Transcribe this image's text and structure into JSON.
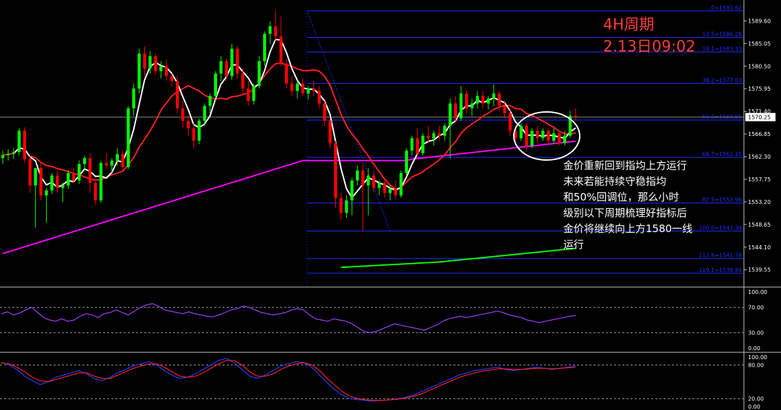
{
  "chart_data": {
    "type": "candlestick",
    "timeframe_label": "4H周期",
    "timestamp_label": "2.13日09:02",
    "commentary": [
      "金价重新回到指均上方运行",
      "未来若能持续守稳指均",
      "和50%回调位，那么小时",
      "级别以下周期梳理好指标后",
      "金价将继续向上方1580一线",
      "运行"
    ],
    "colors": {
      "up": "#00ff00",
      "down": "#ff0000",
      "ma_fast": "#ffffff",
      "ma_mid": "#ff2020",
      "ma_slow": "#ff00ff",
      "ma_long": "#00ff00",
      "fib": "#2030ff",
      "rsi": "#a040ff",
      "stoch_k": "#2040ff",
      "stoch_d": "#ff2020",
      "current": "#808080"
    },
    "price_axis": {
      "ylim": [
        1536.2,
        1593.8
      ],
      "ticks": [
        "1589.60",
        "1585.05",
        "1580.50",
        "1575.95",
        "1571.40",
        "1566.85",
        "1562.30",
        "1557.75",
        "1553.20",
        "1548.65",
        "1544.10",
        "1539.55"
      ],
      "current_price": "1570.25"
    },
    "fibonacci": [
      {
        "label": "0",
        "price": 1591.62,
        "text": "1591.62"
      },
      {
        "label": "12.5",
        "price": 1586.28,
        "text": "1586.28"
      },
      {
        "label": "19.1",
        "price": 1583.33,
        "text": "1583.33"
      },
      {
        "label": "38.2",
        "price": 1577.03,
        "text": "1577.03"
      },
      {
        "label": "50.0",
        "price": 1569.65,
        "text": "1569.65"
      },
      {
        "label": "66.7",
        "price": 1562.15,
        "text": "1562.15"
      },
      {
        "label": "82.5",
        "price": 1552.96,
        "text": "1552.96"
      },
      {
        "label": "100.0",
        "price": 1547.34,
        "text": "1547.34"
      },
      {
        "label": "112.8",
        "price": 1541.78,
        "text": "1541.78"
      },
      {
        "label": "119.1",
        "price": 1538.84,
        "text": "1538.84"
      }
    ],
    "candles": [
      {
        "o": 1562.0,
        "h": 1563.5,
        "l": 1560.8,
        "c": 1562.6
      },
      {
        "o": 1562.6,
        "h": 1563.8,
        "l": 1561.5,
        "c": 1562.9
      },
      {
        "o": 1562.9,
        "h": 1564.0,
        "l": 1561.8,
        "c": 1563.2
      },
      {
        "o": 1563.2,
        "h": 1568.0,
        "l": 1562.5,
        "c": 1567.5
      },
      {
        "o": 1567.5,
        "h": 1568.2,
        "l": 1561.0,
        "c": 1561.8
      },
      {
        "o": 1561.8,
        "h": 1562.5,
        "l": 1555.0,
        "c": 1556.5
      },
      {
        "o": 1556.5,
        "h": 1560.0,
        "l": 1548.0,
        "c": 1560.0
      },
      {
        "o": 1560.0,
        "h": 1561.0,
        "l": 1553.5,
        "c": 1554.5
      },
      {
        "o": 1554.5,
        "h": 1556.0,
        "l": 1549.0,
        "c": 1555.5
      },
      {
        "o": 1555.5,
        "h": 1559.0,
        "l": 1554.8,
        "c": 1558.5
      },
      {
        "o": 1558.5,
        "h": 1559.5,
        "l": 1555.0,
        "c": 1556.0
      },
      {
        "o": 1556.0,
        "h": 1557.0,
        "l": 1553.2,
        "c": 1556.5
      },
      {
        "o": 1556.5,
        "h": 1559.5,
        "l": 1555.8,
        "c": 1559.0
      },
      {
        "o": 1559.0,
        "h": 1560.0,
        "l": 1557.0,
        "c": 1557.5
      },
      {
        "o": 1557.5,
        "h": 1561.5,
        "l": 1556.8,
        "c": 1560.8
      },
      {
        "o": 1560.8,
        "h": 1562.5,
        "l": 1559.5,
        "c": 1562.0
      },
      {
        "o": 1562.0,
        "h": 1563.0,
        "l": 1555.0,
        "c": 1557.0
      },
      {
        "o": 1557.0,
        "h": 1557.5,
        "l": 1552.5,
        "c": 1553.5
      },
      {
        "o": 1553.5,
        "h": 1561.5,
        "l": 1553.0,
        "c": 1561.0
      },
      {
        "o": 1561.0,
        "h": 1563.0,
        "l": 1559.8,
        "c": 1560.5
      },
      {
        "o": 1560.5,
        "h": 1562.0,
        "l": 1559.0,
        "c": 1561.5
      },
      {
        "o": 1561.5,
        "h": 1564.0,
        "l": 1560.5,
        "c": 1562.8
      },
      {
        "o": 1562.8,
        "h": 1563.5,
        "l": 1559.5,
        "c": 1560.2
      },
      {
        "o": 1560.2,
        "h": 1572.5,
        "l": 1559.8,
        "c": 1572.0
      },
      {
        "o": 1572.0,
        "h": 1577.0,
        "l": 1570.5,
        "c": 1576.0
      },
      {
        "o": 1576.0,
        "h": 1584.0,
        "l": 1575.0,
        "c": 1583.0
      },
      {
        "o": 1583.0,
        "h": 1584.5,
        "l": 1578.5,
        "c": 1580.0
      },
      {
        "o": 1580.0,
        "h": 1583.5,
        "l": 1579.0,
        "c": 1582.5
      },
      {
        "o": 1582.5,
        "h": 1583.0,
        "l": 1578.8,
        "c": 1579.5
      },
      {
        "o": 1579.5,
        "h": 1581.5,
        "l": 1578.0,
        "c": 1580.5
      },
      {
        "o": 1580.5,
        "h": 1581.8,
        "l": 1577.5,
        "c": 1578.5
      },
      {
        "o": 1578.5,
        "h": 1579.0,
        "l": 1576.5,
        "c": 1577.5
      },
      {
        "o": 1577.5,
        "h": 1578.5,
        "l": 1571.0,
        "c": 1572.0
      },
      {
        "o": 1572.0,
        "h": 1573.5,
        "l": 1568.0,
        "c": 1569.5
      },
      {
        "o": 1569.5,
        "h": 1570.5,
        "l": 1566.5,
        "c": 1568.0
      },
      {
        "o": 1568.0,
        "h": 1569.0,
        "l": 1564.0,
        "c": 1565.5
      },
      {
        "o": 1565.5,
        "h": 1570.0,
        "l": 1564.8,
        "c": 1569.5
      },
      {
        "o": 1569.5,
        "h": 1573.0,
        "l": 1568.5,
        "c": 1572.5
      },
      {
        "o": 1572.5,
        "h": 1575.0,
        "l": 1571.0,
        "c": 1574.5
      },
      {
        "o": 1574.5,
        "h": 1579.5,
        "l": 1573.5,
        "c": 1579.0
      },
      {
        "o": 1579.0,
        "h": 1582.5,
        "l": 1577.5,
        "c": 1581.5
      },
      {
        "o": 1581.5,
        "h": 1582.0,
        "l": 1577.5,
        "c": 1578.5
      },
      {
        "o": 1578.5,
        "h": 1585.0,
        "l": 1577.8,
        "c": 1584.0
      },
      {
        "o": 1584.0,
        "h": 1584.5,
        "l": 1578.0,
        "c": 1579.0
      },
      {
        "o": 1579.0,
        "h": 1580.0,
        "l": 1575.0,
        "c": 1576.0
      },
      {
        "o": 1576.0,
        "h": 1577.5,
        "l": 1572.5,
        "c": 1573.5
      },
      {
        "o": 1573.5,
        "h": 1577.0,
        "l": 1572.8,
        "c": 1576.5
      },
      {
        "o": 1576.5,
        "h": 1582.5,
        "l": 1576.0,
        "c": 1581.5
      },
      {
        "o": 1581.5,
        "h": 1587.5,
        "l": 1580.5,
        "c": 1587.0
      },
      {
        "o": 1587.0,
        "h": 1589.5,
        "l": 1585.0,
        "c": 1588.5
      },
      {
        "o": 1588.5,
        "h": 1591.6,
        "l": 1585.5,
        "c": 1586.5
      },
      {
        "o": 1586.5,
        "h": 1590.5,
        "l": 1580.5,
        "c": 1581.0
      },
      {
        "o": 1581.0,
        "h": 1582.0,
        "l": 1576.0,
        "c": 1577.0
      },
      {
        "o": 1577.0,
        "h": 1578.5,
        "l": 1574.5,
        "c": 1575.5
      },
      {
        "o": 1575.5,
        "h": 1577.5,
        "l": 1574.0,
        "c": 1577.0
      },
      {
        "o": 1577.0,
        "h": 1578.0,
        "l": 1574.5,
        "c": 1575.0
      },
      {
        "o": 1575.0,
        "h": 1576.5,
        "l": 1573.8,
        "c": 1576.0
      },
      {
        "o": 1576.0,
        "h": 1577.5,
        "l": 1574.5,
        "c": 1575.5
      },
      {
        "o": 1575.5,
        "h": 1576.5,
        "l": 1572.0,
        "c": 1573.0
      },
      {
        "o": 1573.0,
        "h": 1573.5,
        "l": 1568.5,
        "c": 1569.5
      },
      {
        "o": 1569.5,
        "h": 1570.0,
        "l": 1564.0,
        "c": 1565.0
      },
      {
        "o": 1565.0,
        "h": 1565.5,
        "l": 1552.0,
        "c": 1554.0
      },
      {
        "o": 1554.0,
        "h": 1555.0,
        "l": 1549.5,
        "c": 1551.0
      },
      {
        "o": 1551.0,
        "h": 1554.5,
        "l": 1550.0,
        "c": 1553.5
      },
      {
        "o": 1553.5,
        "h": 1558.0,
        "l": 1550.5,
        "c": 1557.5
      },
      {
        "o": 1557.5,
        "h": 1560.5,
        "l": 1556.5,
        "c": 1559.5
      },
      {
        "o": 1559.5,
        "h": 1561.0,
        "l": 1547.3,
        "c": 1556.5
      },
      {
        "o": 1556.5,
        "h": 1560.0,
        "l": 1550.5,
        "c": 1558.5
      },
      {
        "o": 1558.5,
        "h": 1559.5,
        "l": 1555.0,
        "c": 1556.0
      },
      {
        "o": 1556.0,
        "h": 1557.5,
        "l": 1554.5,
        "c": 1557.0
      },
      {
        "o": 1557.0,
        "h": 1558.0,
        "l": 1554.0,
        "c": 1555.0
      },
      {
        "o": 1555.0,
        "h": 1556.5,
        "l": 1553.5,
        "c": 1555.8
      },
      {
        "o": 1555.8,
        "h": 1557.5,
        "l": 1553.8,
        "c": 1554.5
      },
      {
        "o": 1554.5,
        "h": 1559.5,
        "l": 1554.0,
        "c": 1559.0
      },
      {
        "o": 1559.0,
        "h": 1564.0,
        "l": 1558.5,
        "c": 1563.5
      },
      {
        "o": 1563.5,
        "h": 1566.5,
        "l": 1562.5,
        "c": 1566.0
      },
      {
        "o": 1566.0,
        "h": 1568.0,
        "l": 1562.0,
        "c": 1563.0
      },
      {
        "o": 1563.0,
        "h": 1567.0,
        "l": 1562.5,
        "c": 1566.5
      },
      {
        "o": 1566.5,
        "h": 1568.5,
        "l": 1565.0,
        "c": 1566.0
      },
      {
        "o": 1566.0,
        "h": 1567.5,
        "l": 1564.5,
        "c": 1567.0
      },
      {
        "o": 1567.0,
        "h": 1568.5,
        "l": 1565.5,
        "c": 1566.5
      },
      {
        "o": 1566.5,
        "h": 1569.0,
        "l": 1565.5,
        "c": 1568.5
      },
      {
        "o": 1568.5,
        "h": 1574.0,
        "l": 1562.0,
        "c": 1573.0
      },
      {
        "o": 1573.0,
        "h": 1574.5,
        "l": 1569.0,
        "c": 1570.0
      },
      {
        "o": 1570.0,
        "h": 1576.5,
        "l": 1569.5,
        "c": 1575.0
      },
      {
        "o": 1575.0,
        "h": 1575.8,
        "l": 1571.0,
        "c": 1572.0
      },
      {
        "o": 1572.0,
        "h": 1574.0,
        "l": 1570.5,
        "c": 1573.0
      },
      {
        "o": 1573.0,
        "h": 1575.5,
        "l": 1572.0,
        "c": 1574.5
      },
      {
        "o": 1574.5,
        "h": 1575.5,
        "l": 1572.0,
        "c": 1573.0
      },
      {
        "o": 1573.0,
        "h": 1574.5,
        "l": 1571.8,
        "c": 1574.0
      },
      {
        "o": 1574.0,
        "h": 1576.8,
        "l": 1572.5,
        "c": 1575.0
      },
      {
        "o": 1575.0,
        "h": 1575.5,
        "l": 1571.5,
        "c": 1572.5
      },
      {
        "o": 1572.5,
        "h": 1573.5,
        "l": 1570.0,
        "c": 1571.0
      },
      {
        "o": 1571.0,
        "h": 1572.0,
        "l": 1566.5,
        "c": 1567.5
      },
      {
        "o": 1567.5,
        "h": 1568.5,
        "l": 1564.5,
        "c": 1566.0
      },
      {
        "o": 1566.0,
        "h": 1569.0,
        "l": 1565.5,
        "c": 1568.5
      },
      {
        "o": 1568.5,
        "h": 1569.0,
        "l": 1563.5,
        "c": 1564.5
      },
      {
        "o": 1564.5,
        "h": 1568.0,
        "l": 1564.0,
        "c": 1567.5
      },
      {
        "o": 1567.5,
        "h": 1568.5,
        "l": 1565.0,
        "c": 1566.0
      },
      {
        "o": 1566.0,
        "h": 1568.0,
        "l": 1565.5,
        "c": 1567.5
      },
      {
        "o": 1567.5,
        "h": 1568.0,
        "l": 1564.8,
        "c": 1565.5
      },
      {
        "o": 1565.5,
        "h": 1568.0,
        "l": 1565.0,
        "c": 1567.0
      },
      {
        "o": 1567.0,
        "h": 1567.5,
        "l": 1564.5,
        "c": 1565.0
      },
      {
        "o": 1565.0,
        "h": 1567.5,
        "l": 1564.5,
        "c": 1566.5
      },
      {
        "o": 1566.5,
        "h": 1571.5,
        "l": 1566.0,
        "c": 1570.5
      },
      {
        "o": 1570.5,
        "h": 1572.0,
        "l": 1569.5,
        "c": 1570.25
      }
    ],
    "rsi": {
      "ylim": [
        0,
        100
      ],
      "ticks": [
        "100.00",
        "70.00",
        "30.00",
        "0.00"
      ],
      "levels": [
        70,
        30
      ],
      "values": [
        60,
        63,
        58,
        61,
        66,
        70,
        62,
        54,
        50,
        48,
        52,
        48,
        50,
        56,
        60,
        58,
        54,
        60,
        62,
        66,
        62,
        58,
        64,
        70,
        74,
        76,
        72,
        66,
        64,
        62,
        60,
        63,
        60,
        58,
        56,
        55,
        58,
        62,
        66,
        68,
        72,
        70,
        66,
        62,
        60,
        58,
        60,
        62,
        66,
        68,
        66,
        58,
        52,
        50,
        48,
        52,
        50,
        48,
        44,
        38,
        32,
        30,
        32,
        36,
        40,
        44,
        42,
        40,
        38,
        36,
        34,
        38,
        42,
        48,
        52,
        54,
        56,
        54,
        56,
        58,
        60,
        62,
        64,
        62,
        58,
        56,
        54,
        50,
        48,
        46,
        48,
        50,
        52,
        54,
        56,
        57
      ]
    },
    "stochastic": {
      "ylim": [
        0,
        100
      ],
      "ticks": [
        "100.00",
        "80.00",
        "20.00",
        "0.00"
      ],
      "levels": [
        80,
        20
      ],
      "k": [
        85,
        80,
        72,
        60,
        52,
        45,
        50,
        58,
        62,
        66,
        70,
        64,
        56,
        52,
        58,
        66,
        72,
        78,
        82,
        86,
        80,
        70,
        62,
        56,
        58,
        64,
        72,
        80,
        88,
        92,
        84,
        72,
        60,
        56,
        62,
        70,
        78,
        82,
        86,
        84,
        76,
        62,
        48,
        36,
        26,
        20,
        18,
        17,
        16,
        17,
        18,
        20,
        22,
        26,
        32,
        38,
        44,
        50,
        56,
        62,
        66,
        70,
        72,
        74,
        76,
        72,
        70,
        72,
        74,
        76,
        74,
        72,
        74,
        76,
        78
      ],
      "d": [
        84,
        82,
        76,
        68,
        58,
        52,
        50,
        54,
        58,
        62,
        66,
        66,
        60,
        56,
        56,
        62,
        68,
        74,
        78,
        82,
        82,
        76,
        68,
        60,
        58,
        60,
        66,
        74,
        82,
        88,
        88,
        80,
        68,
        60,
        60,
        64,
        72,
        78,
        82,
        84,
        80,
        70,
        56,
        44,
        32,
        24,
        20,
        18,
        17,
        17,
        18,
        19,
        21,
        24,
        28,
        34,
        40,
        46,
        52,
        58,
        62,
        66,
        69,
        71,
        73,
        73,
        72,
        72,
        73,
        74,
        74,
        73,
        74,
        75,
        76
      ]
    }
  }
}
